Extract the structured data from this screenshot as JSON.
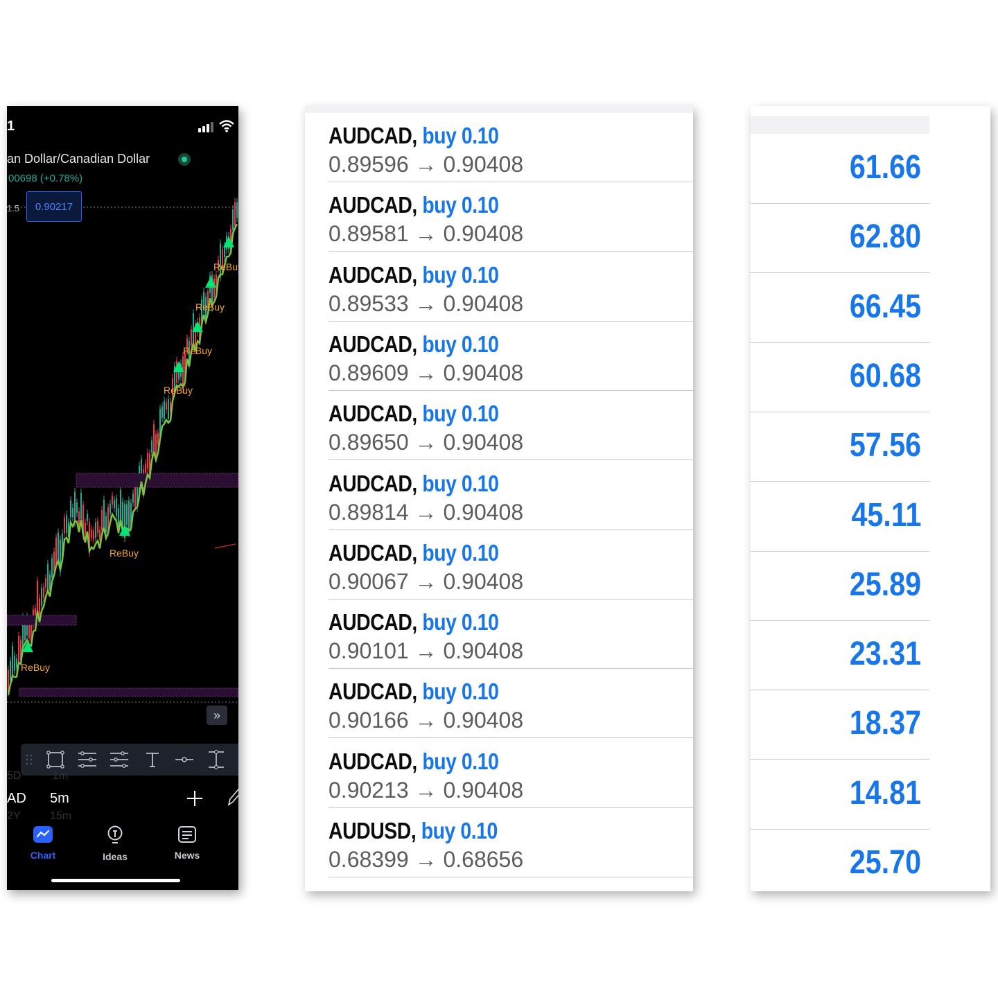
{
  "phone": {
    "status_time": "1",
    "symbol_name": "an Dollar/Canadian Dollar",
    "price_change": "00698 (+0.78%)",
    "axis_tick": "1.5",
    "price_tag": "0.90217",
    "signal_label": "ReBuy",
    "timeframes": {
      "left_dim_top": "5D",
      "left_main": "AD",
      "left_dim_bottom": "2Y",
      "center_dim_top": "1m",
      "center_main": "5m",
      "center_dim_bottom": "15m"
    },
    "nav": [
      {
        "label": "Chart",
        "icon": "chart-icon",
        "active": true
      },
      {
        "label": "Ideas",
        "icon": "lightbulb-icon",
        "active": false
      },
      {
        "label": "News",
        "icon": "news-icon",
        "active": false
      }
    ],
    "colors": {
      "up": "#22ab94",
      "down": "#f23645",
      "signal": "#00e676",
      "label": "#f5a623",
      "accent": "#2962ff"
    }
  },
  "trades": [
    {
      "symbol": "AUDCAD,",
      "direction": "buy 0.10",
      "open": "0.89596",
      "arrow": "→",
      "close": "0.90408"
    },
    {
      "symbol": "AUDCAD,",
      "direction": "buy 0.10",
      "open": "0.89581",
      "arrow": "→",
      "close": "0.90408"
    },
    {
      "symbol": "AUDCAD,",
      "direction": "buy 0.10",
      "open": "0.89533",
      "arrow": "→",
      "close": "0.90408"
    },
    {
      "symbol": "AUDCAD,",
      "direction": "buy 0.10",
      "open": "0.89609",
      "arrow": "→",
      "close": "0.90408"
    },
    {
      "symbol": "AUDCAD,",
      "direction": "buy 0.10",
      "open": "0.89650",
      "arrow": "→",
      "close": "0.90408"
    },
    {
      "symbol": "AUDCAD,",
      "direction": "buy 0.10",
      "open": "0.89814",
      "arrow": "→",
      "close": "0.90408"
    },
    {
      "symbol": "AUDCAD,",
      "direction": "buy 0.10",
      "open": "0.90067",
      "arrow": "→",
      "close": "0.90408"
    },
    {
      "symbol": "AUDCAD,",
      "direction": "buy 0.10",
      "open": "0.90101",
      "arrow": "→",
      "close": "0.90408"
    },
    {
      "symbol": "AUDCAD,",
      "direction": "buy 0.10",
      "open": "0.90166",
      "arrow": "→",
      "close": "0.90408"
    },
    {
      "symbol": "AUDCAD,",
      "direction": "buy 0.10",
      "open": "0.90213",
      "arrow": "→",
      "close": "0.90408"
    },
    {
      "symbol": "AUDUSD,",
      "direction": "buy 0.10",
      "open": "0.68399",
      "arrow": "→",
      "close": "0.68656"
    }
  ],
  "profits": [
    "61.66",
    "62.80",
    "66.45",
    "60.68",
    "57.56",
    "45.11",
    "25.89",
    "23.31",
    "18.37",
    "14.81",
    "25.70"
  ]
}
